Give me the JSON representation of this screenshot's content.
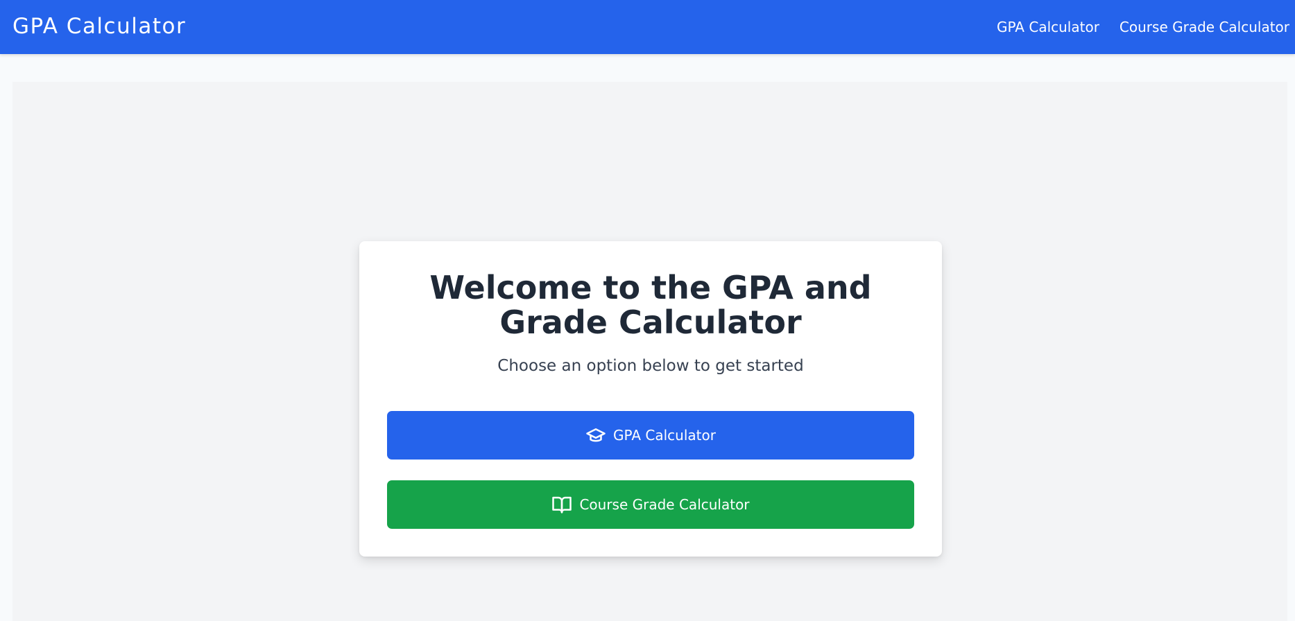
{
  "navbar": {
    "brand": "GPA Calculator",
    "links": [
      {
        "label": "GPA Calculator"
      },
      {
        "label": "Course Grade Calculator"
      }
    ]
  },
  "card": {
    "title": "Welcome to the GPA and Grade Calculator",
    "subtitle": "Choose an option below to get started",
    "buttons": [
      {
        "label": "GPA Calculator",
        "icon": "graduation-cap-icon",
        "color": "#2563eb"
      },
      {
        "label": "Course Grade Calculator",
        "icon": "open-book-icon",
        "color": "#16a34a"
      }
    ]
  },
  "colors": {
    "primary": "#2563eb",
    "success": "#16a34a",
    "heading": "#1f2937",
    "background": "#f3f4f6"
  }
}
